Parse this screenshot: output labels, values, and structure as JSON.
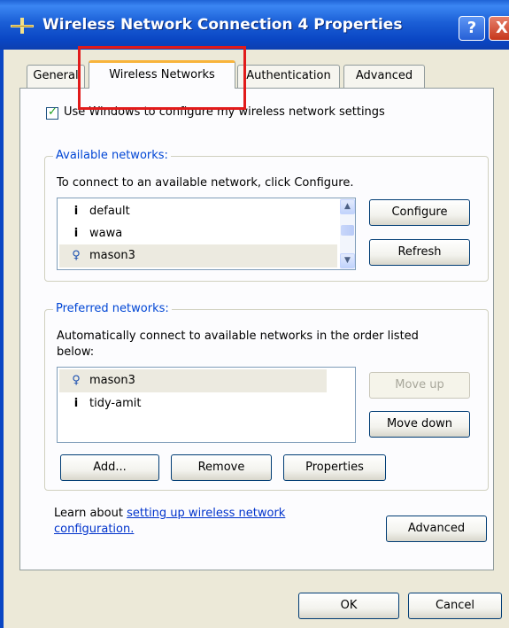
{
  "window": {
    "title": "Wireless Network Connection 4 Properties",
    "help_glyph": "?",
    "close_glyph": "X"
  },
  "tabs": [
    {
      "label": "General"
    },
    {
      "label": "Wireless Networks",
      "active": true
    },
    {
      "label": "Authentication"
    },
    {
      "label": "Advanced"
    }
  ],
  "settings": {
    "use_windows_label": "Use Windows to configure my wireless network settings",
    "use_windows_checked": true
  },
  "available": {
    "legend": "Available networks:",
    "instruction": "To connect to an available network, click Configure.",
    "networks": [
      {
        "name": "default",
        "icon": "antenna-icon",
        "glyph": "i"
      },
      {
        "name": "wawa",
        "icon": "antenna-icon",
        "glyph": "i"
      },
      {
        "name": "mason3",
        "icon": "wireless-active-icon",
        "glyph": "♀",
        "selected": true
      }
    ],
    "configure_label": "Configure",
    "refresh_label": "Refresh"
  },
  "preferred": {
    "legend": "Preferred networks:",
    "instruction_line1": "Automatically connect to available networks in the order listed",
    "instruction_line2": "below:",
    "networks": [
      {
        "name": "mason3",
        "icon": "wireless-active-icon",
        "glyph": "♀",
        "selected": true
      },
      {
        "name": "tidy-amit",
        "icon": "antenna-icon",
        "glyph": "i"
      }
    ],
    "move_up_label": "Move up",
    "move_down_label": "Move down",
    "add_label": "Add...",
    "remove_label": "Remove",
    "properties_label": "Properties"
  },
  "footer": {
    "learn_prefix": "Learn about ",
    "learn_link_line1": "setting up wireless network",
    "learn_link_line2": "configuration.",
    "advanced_label": "Advanced",
    "ok_label": "OK",
    "cancel_label": "Cancel"
  },
  "colors": {
    "titlebar": "#0a46c4",
    "legend_text": "#0046d5",
    "highlight": "#e11b1b"
  }
}
